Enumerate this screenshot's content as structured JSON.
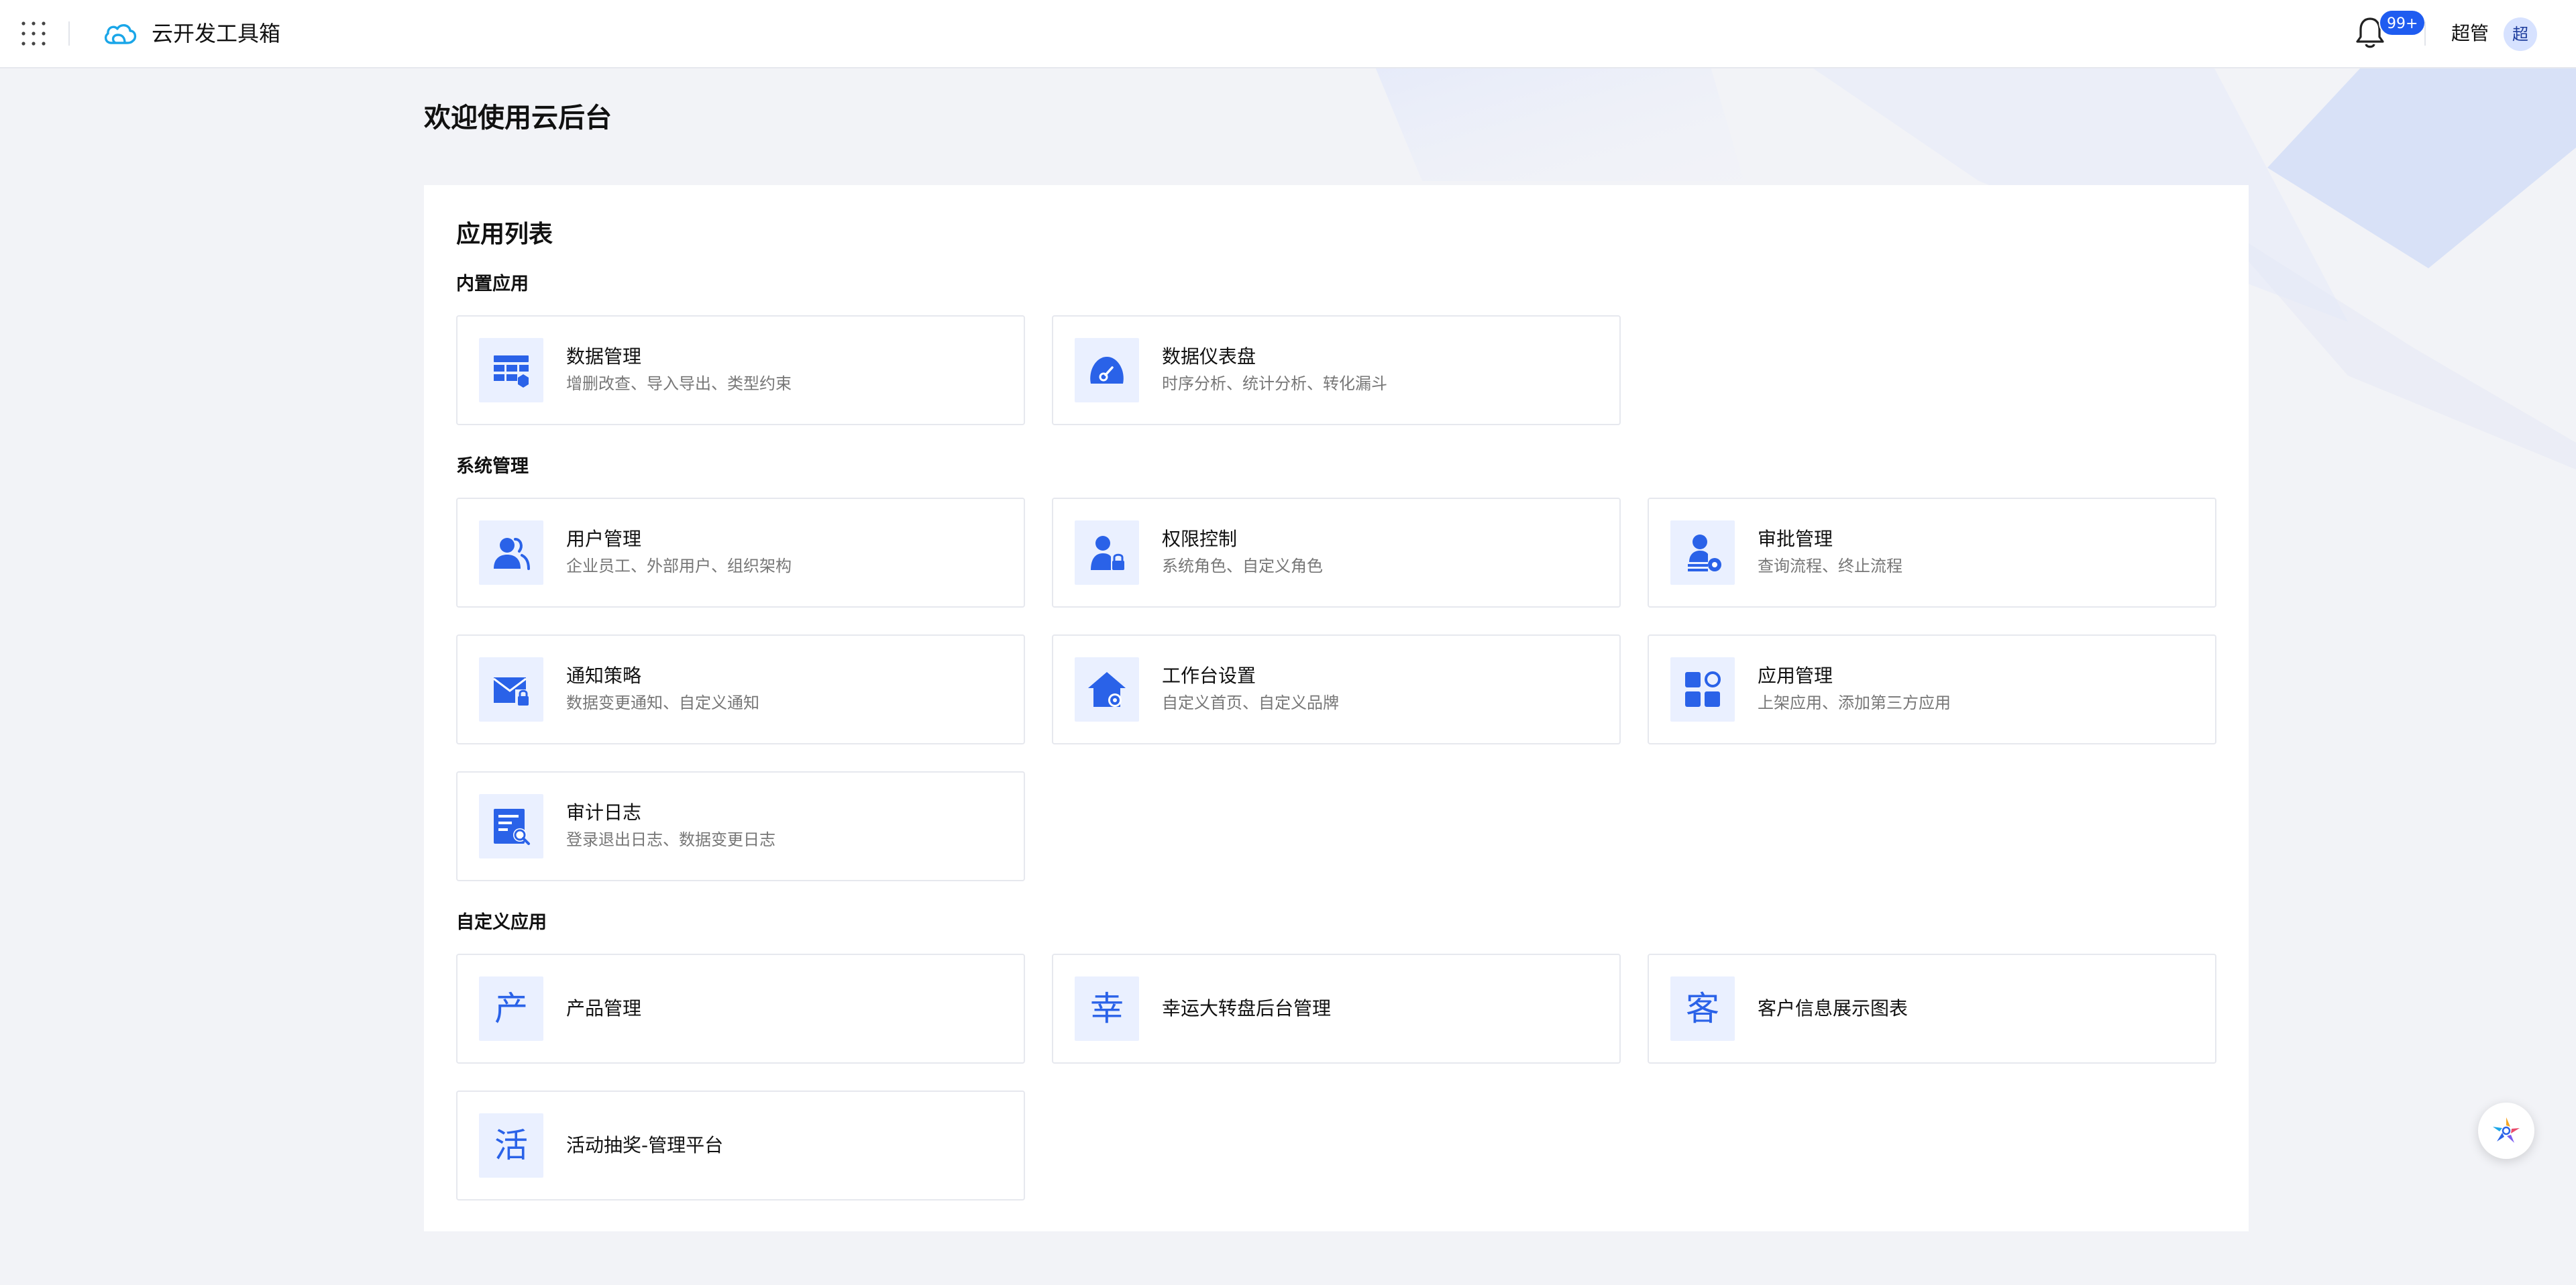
{
  "header": {
    "brand": "云开发工具箱",
    "notification_badge": "99+",
    "username": "超管",
    "avatar_text": "超"
  },
  "welcome": "欢迎使用云后台",
  "panel": {
    "title": "应用列表",
    "sections": [
      {
        "title": "内置应用",
        "cards": [
          {
            "title": "数据管理",
            "desc": "增删改查、导入导出、类型约束",
            "icon": "table-icon"
          },
          {
            "title": "数据仪表盘",
            "desc": "时序分析、统计分析、转化漏斗",
            "icon": "dashboard-gauge-icon"
          }
        ]
      },
      {
        "title": "系统管理",
        "cards": [
          {
            "title": "用户管理",
            "desc": "企业员工、外部用户、组织架构",
            "icon": "users-icon"
          },
          {
            "title": "权限控制",
            "desc": "系统角色、自定义角色",
            "icon": "user-lock-icon"
          },
          {
            "title": "审批管理",
            "desc": "查询流程、终止流程",
            "icon": "approver-icon"
          },
          {
            "title": "通知策略",
            "desc": "数据变更通知、自定义通知",
            "icon": "mail-lock-icon"
          },
          {
            "title": "工作台设置",
            "desc": "自定义首页、自定义品牌",
            "icon": "home-gear-icon"
          },
          {
            "title": "应用管理",
            "desc": "上架应用、添加第三方应用",
            "icon": "apps-grid-icon"
          },
          {
            "title": "审计日志",
            "desc": "登录退出日志、数据变更日志",
            "icon": "log-search-icon"
          }
        ]
      },
      {
        "title": "自定义应用",
        "cards": [
          {
            "title": "产品管理",
            "char": "产"
          },
          {
            "title": "幸运大转盘后台管理",
            "char": "幸"
          },
          {
            "title": "客户信息展示图表",
            "char": "客"
          },
          {
            "title": "活动抽奖-管理平台",
            "char": "活"
          }
        ]
      }
    ]
  },
  "colors": {
    "accent": "#2a62e8",
    "icon_bg": "#eaf0ff",
    "badge": "#1f5cf0"
  }
}
